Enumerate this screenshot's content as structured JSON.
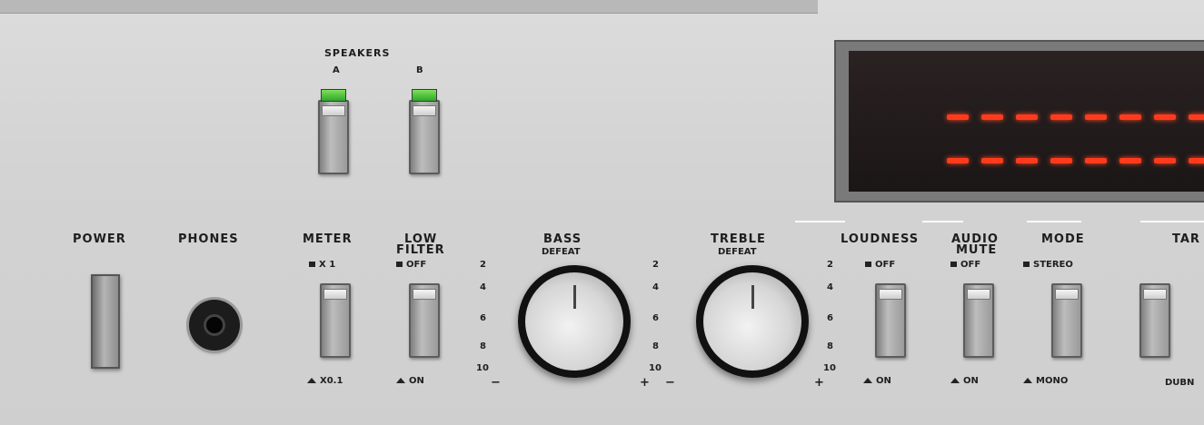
{
  "speakers": {
    "title": "SPEAKERS",
    "a": "A",
    "b": "B"
  },
  "controls": {
    "power": "POWER",
    "phones": "PHONES",
    "meter": {
      "title": "METER",
      "top": "X 1",
      "bottom": "X0.1"
    },
    "low_filter": {
      "title_line1": "LOW",
      "title_line2": "FILTER",
      "top": "OFF",
      "bottom": "ON"
    },
    "bass": {
      "title": "BASS",
      "defeat": "DEFEAT",
      "minus": "−",
      "plus": "+",
      "left_ticks": [
        "2",
        "4",
        "6",
        "8",
        "10"
      ],
      "right_ticks": [
        "2",
        "4",
        "6",
        "8",
        "10"
      ]
    },
    "treble": {
      "title": "TREBLE",
      "defeat": "DEFEAT",
      "minus": "−",
      "plus": "+",
      "right_ticks": [
        "2",
        "4",
        "6",
        "8",
        "10"
      ]
    },
    "loudness": {
      "title": "LOUDNESS",
      "top": "OFF",
      "bottom": "ON"
    },
    "audio_mute": {
      "title_line1": "AUDIO",
      "title_line2": "MUTE",
      "top": "OFF",
      "bottom": "ON"
    },
    "mode": {
      "title": "MODE",
      "top": "STEREO",
      "bottom": "MONO"
    },
    "tape": {
      "title": "TAR",
      "bottom": "DUBN"
    }
  },
  "colors": {
    "panel": "#d3d3d3",
    "led": "#ff3b1c",
    "speaker_led": "#2ea72a"
  }
}
